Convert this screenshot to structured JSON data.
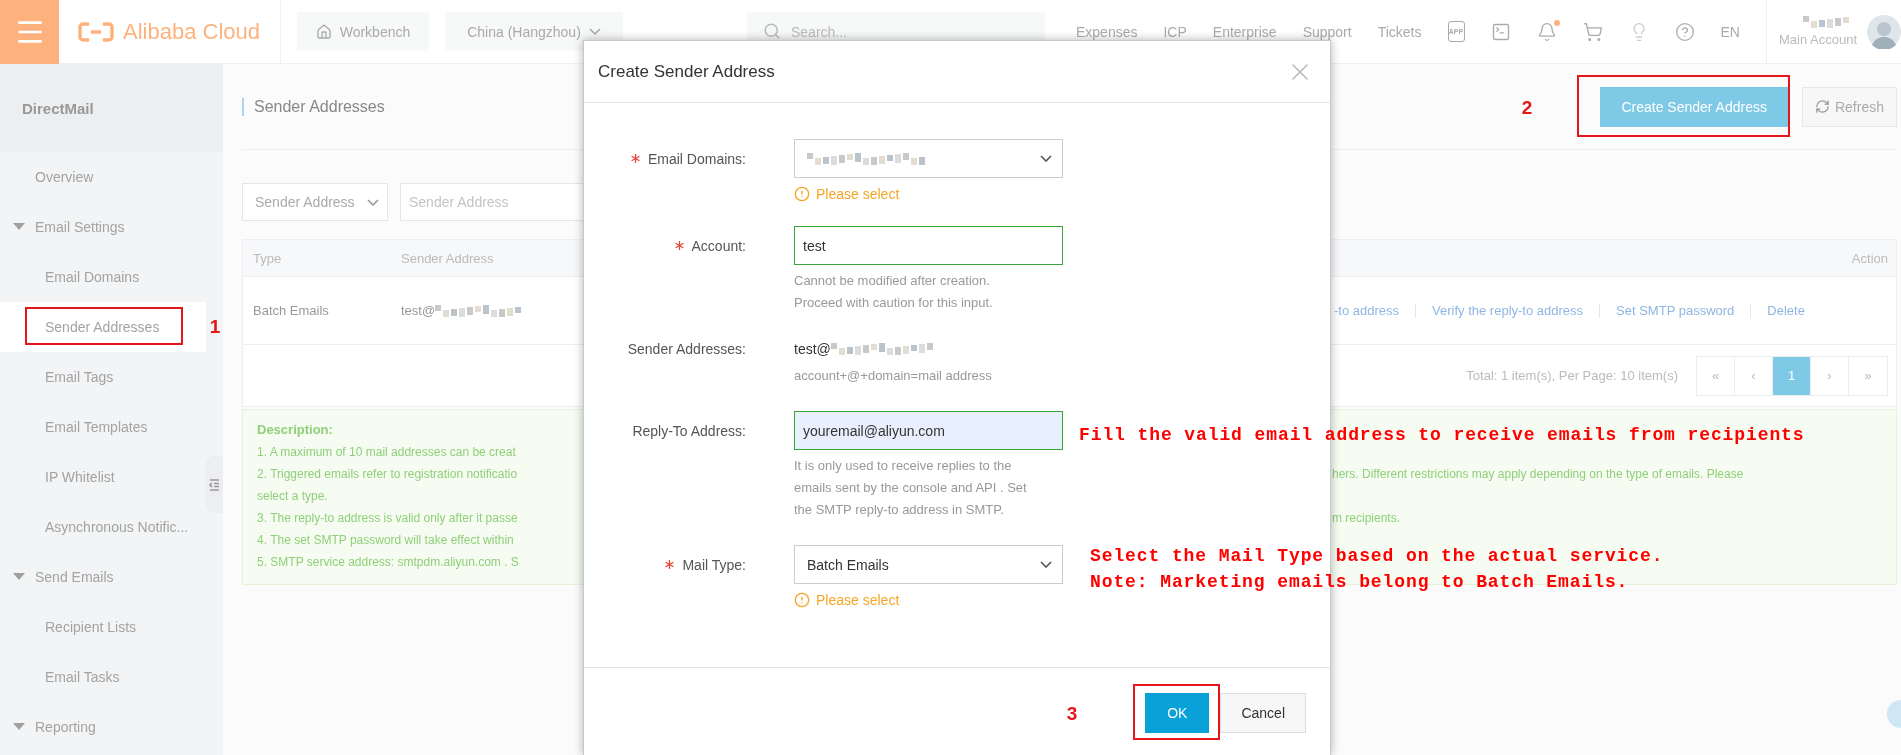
{
  "topbar": {
    "brand": "Alibaba Cloud",
    "workbench": "Workbench",
    "region": "China (Hangzhou)",
    "search": {
      "placeholder": "Search..."
    },
    "links": [
      "Expenses",
      "ICP",
      "Enterprise",
      "Support",
      "Tickets"
    ],
    "icons": [
      {
        "kind": "app",
        "label": "APP"
      },
      {
        "kind": "terminal"
      },
      {
        "kind": "bell",
        "badge": true
      },
      {
        "kind": "cart"
      },
      {
        "kind": "bulb"
      },
      {
        "kind": "help"
      }
    ],
    "language": "EN",
    "account": {
      "role": "Main Account",
      "redacted": true
    }
  },
  "sidebar": {
    "title": "DirectMail",
    "items": [
      {
        "label": "Overview",
        "selected": false
      },
      {
        "label": "Email Settings",
        "selected": false,
        "expanded": true,
        "children": [
          {
            "label": "Email Domains",
            "selected": false
          },
          {
            "label": "Sender Addresses",
            "selected": true
          },
          {
            "label": "Email Tags",
            "selected": false
          },
          {
            "label": "Email Templates",
            "selected": false
          },
          {
            "label": "IP Whitelist",
            "selected": false
          },
          {
            "label": "Asynchronous Notific...",
            "selected": false
          }
        ]
      },
      {
        "label": "Send Emails",
        "selected": false,
        "expanded": true,
        "children": [
          {
            "label": "Recipient Lists",
            "selected": false
          },
          {
            "label": "Email Tasks",
            "selected": false
          }
        ]
      },
      {
        "label": "Reporting",
        "selected": false,
        "expanded": true
      }
    ]
  },
  "page": {
    "title": "Sender Addresses",
    "actions": [
      {
        "label": "Create Sender Address",
        "kind": "primary"
      },
      {
        "label": "Refresh",
        "kind": "refresh"
      }
    ]
  },
  "filter": {
    "field": "Sender Address",
    "search": {
      "placeholder": "Sender Address"
    }
  },
  "table": {
    "columns": [
      "Type",
      "Sender Address",
      "Action"
    ],
    "rows": [
      {
        "type": "Batch Emails",
        "sender": "test@",
        "redacted": true,
        "actions": [
          "-to address",
          "Verify the reply-to address",
          "Set SMTP password",
          "Delete"
        ]
      }
    ]
  },
  "pager": {
    "summary": "Total: 1 item(s), Per Page: 10 item(s)",
    "buttons": [
      {
        "label": "«",
        "selected": false
      },
      {
        "label": "‹",
        "selected": false
      },
      {
        "label": "1",
        "selected": true
      },
      {
        "label": "›",
        "selected": false
      },
      {
        "label": "»",
        "selected": false
      }
    ]
  },
  "description": {
    "title": "Description:",
    "lines": [
      {
        "left": "1. A maximum of 10 mail addresses can be creat"
      },
      {
        "left": "2. Triggered emails refer to registration notificatio",
        "right": "hers. Different restrictions may apply depending on the type of emails. Please"
      },
      {
        "left": "select a type."
      },
      {
        "left": "3. The reply-to address is valid only after it passe",
        "right": "m recipients."
      },
      {
        "left": "4. The set SMTP password will take effect within"
      },
      {
        "left": "5. SMTP service address: smtpdm.aliyun.com . S"
      }
    ]
  },
  "dialog": {
    "title": "Create Sender Address",
    "fields": [
      {
        "kind": "select",
        "label": "Email Domains:",
        "required": true,
        "redacted": true,
        "warning": "Please select"
      },
      {
        "kind": "input",
        "label": "Account:",
        "required": true,
        "value": "test",
        "valid": true,
        "autofilled": false,
        "help": "Cannot be modified after creation. Proceed with caution for this input."
      },
      {
        "kind": "static",
        "label": "Sender Addresses:",
        "required": false,
        "value": "test@",
        "redacted": true,
        "help": "account+@+domain=mail address"
      },
      {
        "kind": "input",
        "label": "Reply-To Address:",
        "required": false,
        "value": "youremail@aliyun.com",
        "valid": true,
        "autofilled": true,
        "help": "It is only used to receive replies to the emails sent by the console and API . Set the SMTP reply-to address in SMTP."
      },
      {
        "kind": "select",
        "label": "Mail Type:",
        "required": true,
        "value": "Batch Emails",
        "warning": "Please select"
      }
    ],
    "buttons": [
      {
        "label": "OK",
        "kind": "primary"
      },
      {
        "label": "Cancel",
        "kind": "default"
      }
    ]
  },
  "annotations": {
    "steps": [
      "1",
      "2",
      "3"
    ],
    "notes": [
      "Fill the valid email address to receive emails from recipients",
      "Select the Mail Type based on the actual service.",
      "Note: Marketing emails belong to Batch Emails."
    ]
  }
}
